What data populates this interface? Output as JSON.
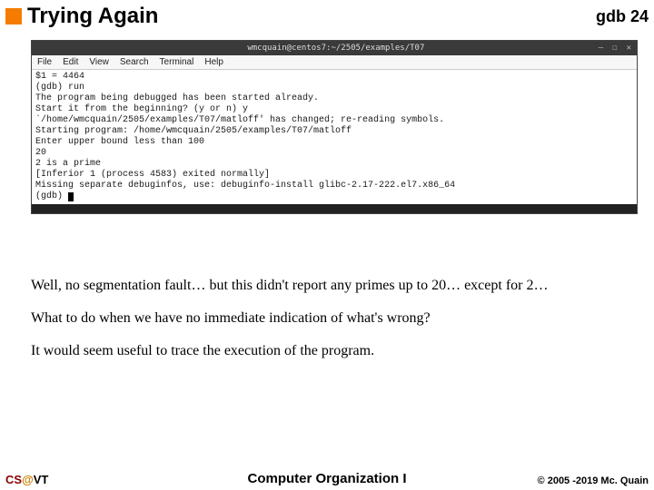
{
  "header": {
    "title": "Trying Again",
    "right_label": "gdb",
    "page_number": "24"
  },
  "terminal": {
    "titlebar": "wmcquain@centos7:~/2505/examples/T07",
    "wincontrols": {
      "min": "—",
      "max": "☐",
      "close": "✕"
    },
    "menu": [
      "File",
      "Edit",
      "View",
      "Search",
      "Terminal",
      "Help"
    ],
    "lines": [
      "$1 = 4464",
      "(gdb) run",
      "The program being debugged has been started already.",
      "Start it from the beginning? (y or n) y",
      "`/home/wmcquain/2505/examples/T07/matloff' has changed; re-reading symbols.",
      "Starting program: /home/wmcquain/2505/examples/T07/matloff",
      "Enter upper bound less than 100",
      "20",
      "2 is a prime",
      "[Inferior 1 (process 4583) exited normally]",
      "Missing separate debuginfos, use: debuginfo-install glibc-2.17-222.el7.x86_64",
      "(gdb) "
    ]
  },
  "body": {
    "p1": "Well, no segmentation fault… but this didn't report any primes up to 20… except for 2…",
    "p2": "What to do when we have no immediate indication of what's wrong?",
    "p3": "It would seem useful to trace the execution of the program."
  },
  "footer": {
    "left_cs": "CS",
    "left_at": "@",
    "left_vt": "VT",
    "center": "Computer Organization I",
    "right": "© 2005 -2019 Mc. Quain"
  }
}
